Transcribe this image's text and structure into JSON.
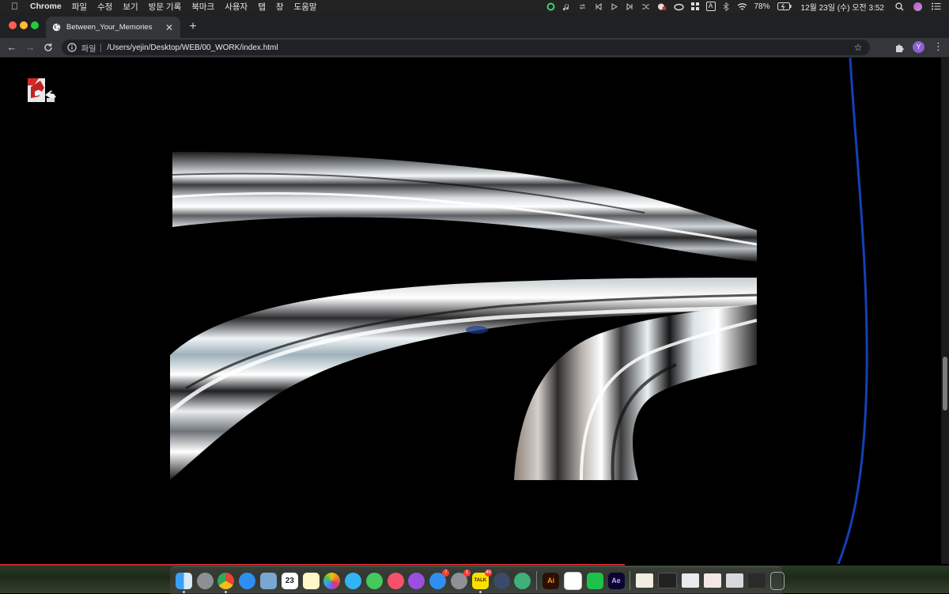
{
  "menubar": {
    "app_name": "Chrome",
    "items": [
      "파일",
      "수정",
      "보기",
      "방문 기록",
      "북마크",
      "사용자",
      "탭",
      "창",
      "도움말"
    ],
    "battery": "78%",
    "input_source": "A",
    "clock": "12월 23일 (수) 오전  3:52"
  },
  "tab": {
    "title": "Between_Your_Memories"
  },
  "toolbar": {
    "scheme_label": "파일",
    "url": "/Users/yejin/Desktop/WEB/00_WORK/index.html",
    "profile_initial": "Y"
  },
  "page": {
    "accent_colors": {
      "scroll_line": "#1440b8",
      "progress_line": "#c8262a"
    }
  },
  "dock": {
    "calendar_day": "23",
    "badges": {
      "appstore": "7",
      "system_preferences": "1",
      "kakaotalk": "40"
    },
    "illustrator_label": "Ai",
    "aftereffects_label": "Ae",
    "kakaotalk_label": "TALK"
  }
}
